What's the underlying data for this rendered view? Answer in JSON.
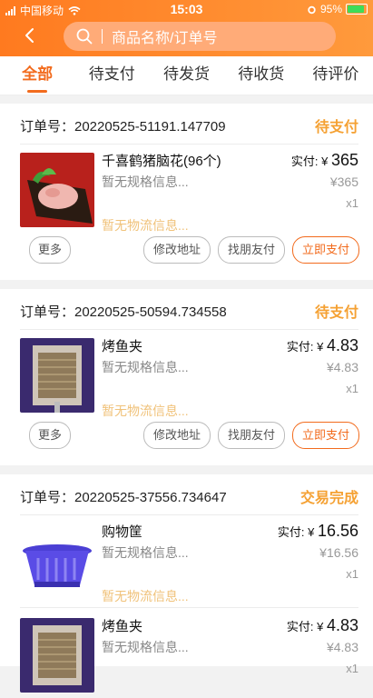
{
  "status_bar": {
    "carrier": "中国移动",
    "time": "15:03",
    "battery": "95%"
  },
  "search": {
    "placeholder": "商品名称/订单号"
  },
  "tabs": [
    "全部",
    "待支付",
    "待发货",
    "待收货",
    "待评价"
  ],
  "orders": [
    {
      "order_label": "订单号：20220525-51191.147709",
      "status": "待支付",
      "items": [
        {
          "name": "千喜鹤猪脑花(96个)",
          "spec": "暂无规格信息...",
          "logistics": "暂无物流信息...",
          "paid_label": "实付: ¥ ",
          "paid": "365",
          "price": "¥365",
          "qty": "x1"
        }
      ],
      "buttons": [
        "更多",
        "修改地址",
        "找朋友付",
        "立即支付"
      ]
    },
    {
      "order_label": "订单号：20220525-50594.734558",
      "status": "待支付",
      "items": [
        {
          "name": "烤鱼夹",
          "spec": "暂无规格信息...",
          "logistics": "暂无物流信息...",
          "paid_label": "实付: ¥ ",
          "paid": "4.83",
          "price": "¥4.83",
          "qty": "x1"
        }
      ],
      "buttons": [
        "更多",
        "修改地址",
        "找朋友付",
        "立即支付"
      ]
    },
    {
      "order_label": "订单号：20220525-37556.734647",
      "status": "交易完成",
      "items": [
        {
          "name": "购物筐",
          "spec": "暂无规格信息...",
          "logistics": "暂无物流信息...",
          "paid_label": "实付: ¥ ",
          "paid": "16.56",
          "price": "¥16.56",
          "qty": "x1"
        },
        {
          "name": "烤鱼夹",
          "spec": "暂无规格信息...",
          "logistics": "",
          "paid_label": "实付: ¥ ",
          "paid": "4.83",
          "price": "¥4.83",
          "qty": "x1"
        }
      ],
      "buttons": []
    }
  ],
  "colors": {
    "accent": "#f26b1d",
    "header_start": "#ff7a1f",
    "header_end": "#ff9a3c",
    "status_text": "#f5a133"
  },
  "icons": {
    "back": "chevron-left-icon",
    "search": "search-icon",
    "wifi": "wifi-icon",
    "alarm": "alarm-icon",
    "battery": "battery-icon",
    "signal": "signal-icon"
  }
}
